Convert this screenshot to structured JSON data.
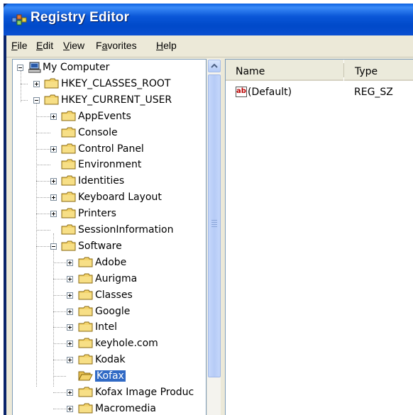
{
  "window": {
    "title": "Registry Editor"
  },
  "menu": [
    {
      "label": "File",
      "accel": "F",
      "rest": "ile"
    },
    {
      "label": "Edit",
      "accel": "E",
      "rest": "dit"
    },
    {
      "label": "View",
      "accel": "V",
      "rest": "iew"
    },
    {
      "label": "Favorites",
      "accel": "a",
      "pre": "F",
      "rest": "vorites"
    },
    {
      "label": "Help",
      "accel": "H",
      "rest": "elp"
    }
  ],
  "tree": {
    "root": "My Computer",
    "hives": [
      "HKEY_CLASSES_ROOT",
      "HKEY_CURRENT_USER"
    ],
    "hkcu_children": [
      "AppEvents",
      "Console",
      "Control Panel",
      "Environment",
      "Identities",
      "Keyboard Layout",
      "Printers",
      "SessionInformation",
      "Software"
    ],
    "software_children": [
      "Adobe",
      "Aurigma",
      "Classes",
      "Google",
      "Intel",
      "keyhole.com",
      "Kodak",
      "Kofax",
      "Kofax Image Produc",
      "Macromedia"
    ],
    "selected": "Kofax"
  },
  "list": {
    "columns": [
      "Name",
      "Type"
    ],
    "rows": [
      {
        "name": "(Default)",
        "type": "REG_SZ",
        "icon": "string-value-icon"
      }
    ]
  },
  "colors": {
    "title_bar": "#0a4fd0",
    "selection": "#316ac5",
    "chrome": "#ece9d8",
    "folder": "#f3d36b"
  }
}
